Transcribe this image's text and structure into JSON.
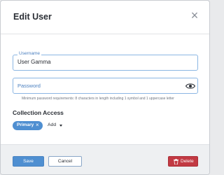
{
  "dialog": {
    "title": "Edit User",
    "close_icon": "close-icon"
  },
  "username": {
    "label": "Username",
    "value": "User Gamma"
  },
  "password": {
    "placeholder": "Password",
    "visibility_icon": "eye-icon",
    "hint": "Minimum password requirements: 8 characters in length including 1 symbol and 1 uppercase letter"
  },
  "collection_access": {
    "title": "Collection Access",
    "chips": [
      {
        "label": "Primary"
      }
    ],
    "add_label": "Add"
  },
  "footer": {
    "save_label": "Save",
    "cancel_label": "Cancel",
    "delete_label": "Delete",
    "delete_icon": "trash-icon"
  },
  "colors": {
    "primary": "#4f8fd1",
    "danger": "#c23a43",
    "field_border": "#8bb6e3",
    "footer_bg": "#eef0f2"
  }
}
